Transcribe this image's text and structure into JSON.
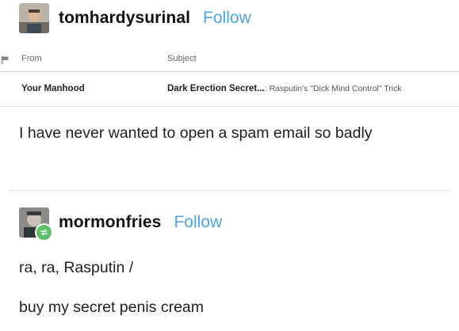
{
  "post1": {
    "username": "tomhardysurinal",
    "follow_label": "Follow",
    "text": "I have never wanted to open a spam email so badly"
  },
  "email": {
    "from_header": "From",
    "subject_header": "Subject",
    "from_value": "Your Manhood",
    "subject_bold": "Dark Erection Secret...",
    "subject_rest": ": Rasputin's \"Dick Mind Control\" Trick"
  },
  "post2": {
    "username": "mormonfries",
    "follow_label": "Follow",
    "line1": "ra, ra, Rasputin /",
    "line2": "buy my secret penis cream"
  },
  "colors": {
    "follow_blue": "#4fa3e3",
    "reblog_green": "#5ec26a",
    "divider_gray": "#e1e1e1"
  }
}
